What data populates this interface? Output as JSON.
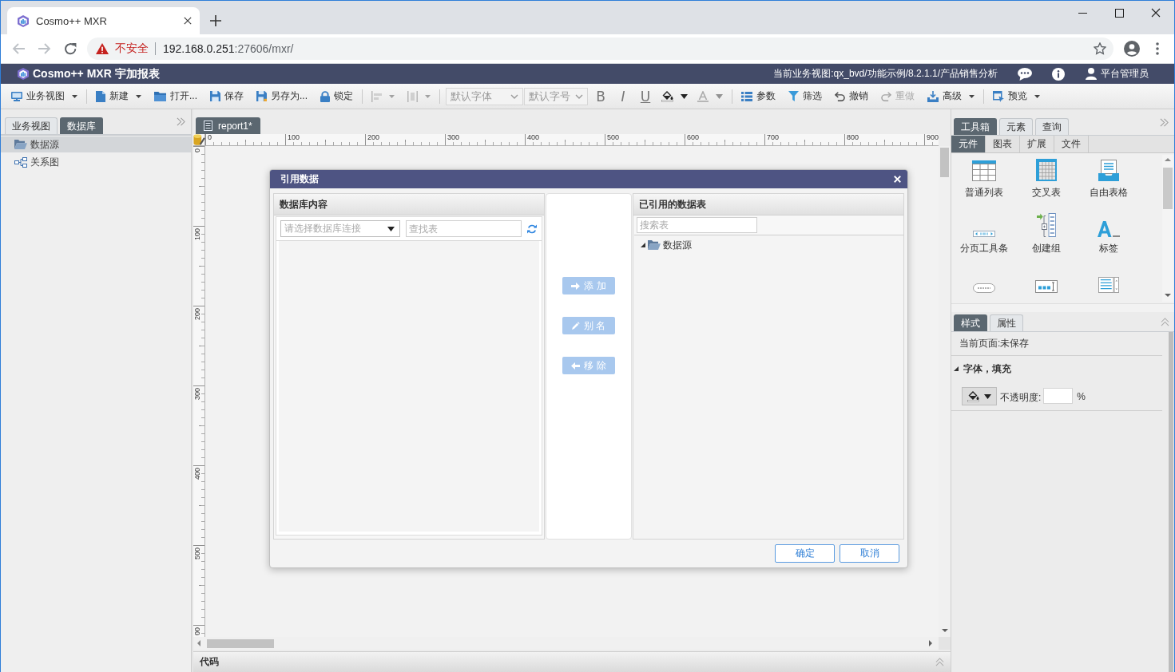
{
  "browser": {
    "tab_title": "Cosmo++ MXR",
    "security_label": "不安全",
    "url_host": "192.168.0.251",
    "url_rest": ":27606/mxr/"
  },
  "app": {
    "title": "Cosmo++ MXR 宇加报表",
    "context": "当前业务视图:qx_bvd/功能示例/8.2.1.1/产品销售分析",
    "user": "平台管理员"
  },
  "toolbar": {
    "groups": [
      [
        {
          "kind": "button",
          "label": "业务视图",
          "menu": true,
          "disabled": false
        }
      ],
      [
        {
          "kind": "button",
          "label": "新建",
          "menu": true,
          "disabled": false
        },
        {
          "kind": "button",
          "label": "打开...",
          "menu": false,
          "disabled": false
        },
        {
          "kind": "button",
          "label": "保存",
          "menu": false,
          "disabled": false
        },
        {
          "kind": "button",
          "label": "另存为...",
          "menu": false,
          "disabled": false
        },
        {
          "kind": "button",
          "label": "锁定",
          "menu": false,
          "disabled": false
        }
      ],
      [
        {
          "kind": "icon-button",
          "menu": true,
          "disabled": true
        },
        {
          "kind": "icon-button",
          "menu": true,
          "disabled": true
        }
      ],
      [
        {
          "kind": "select",
          "value": "默认字体",
          "disabled": true
        },
        {
          "kind": "select",
          "value": "默认字号",
          "disabled": true
        },
        {
          "kind": "bold",
          "label": "B",
          "disabled": false
        },
        {
          "kind": "italic",
          "label": "I",
          "disabled": false
        },
        {
          "kind": "underline",
          "label": "U",
          "disabled": false
        },
        {
          "kind": "icon-button",
          "menu": true,
          "disabled": false
        },
        {
          "kind": "icon-button",
          "menu": true,
          "disabled": true
        }
      ],
      [
        {
          "kind": "button",
          "label": "参数",
          "menu": false,
          "disabled": false
        },
        {
          "kind": "button",
          "label": "筛选",
          "menu": false,
          "disabled": false
        },
        {
          "kind": "button",
          "label": "撤销",
          "menu": false,
          "disabled": false
        },
        {
          "kind": "button",
          "label": "重做",
          "menu": false,
          "disabled": true
        },
        {
          "kind": "button",
          "label": "高级",
          "menu": true,
          "disabled": false
        }
      ],
      [
        {
          "kind": "button",
          "label": "预览",
          "menu": true,
          "disabled": false
        }
      ]
    ]
  },
  "left_panel": {
    "tabs": [
      {
        "label": "业务视图",
        "selected": false
      },
      {
        "label": "数据库",
        "selected": true
      }
    ],
    "tree": [
      {
        "kind": "folder",
        "label": "数据源",
        "selected": true
      },
      {
        "kind": "diagram",
        "label": "关系图",
        "selected": false
      }
    ]
  },
  "documents": [
    {
      "label": "report1*",
      "selected": true
    }
  ],
  "ruler": {
    "horizontal": [
      "0",
      "100",
      "200",
      "300",
      "400",
      "500",
      "600",
      "700",
      "800",
      "900"
    ],
    "vertical": [
      "0",
      "100",
      "200",
      "300",
      "400",
      "500",
      "00"
    ]
  },
  "dialog": {
    "title": "引用数据",
    "left": {
      "header": "数据库内容",
      "connection_placeholder": "请选择数据库连接",
      "search_placeholder": "查找表"
    },
    "actions": [
      {
        "label": "添 加",
        "disabled": true
      },
      {
        "label": "别 名",
        "disabled": true
      },
      {
        "label": "移 除",
        "disabled": true
      }
    ],
    "right": {
      "header": "已引用的数据表",
      "search_placeholder": "搜索表",
      "tree": [
        {
          "label": "数据源",
          "expanded": true
        }
      ]
    },
    "buttons": [
      {
        "label": "确定"
      },
      {
        "label": "取消"
      }
    ]
  },
  "right_panel": {
    "tabs": [
      {
        "label": "工具箱",
        "selected": true
      },
      {
        "label": "元素",
        "selected": false
      },
      {
        "label": "查询",
        "selected": false
      }
    ],
    "subtabs": [
      {
        "label": "元件",
        "selected": true
      },
      {
        "label": "图表",
        "selected": false
      },
      {
        "label": "扩展",
        "selected": false
      },
      {
        "label": "文件",
        "selected": false
      }
    ],
    "components": [
      {
        "kind": "table",
        "label": "普通列表"
      },
      {
        "kind": "crosstab",
        "label": "交叉表"
      },
      {
        "kind": "freeform",
        "label": "自由表格"
      },
      {
        "kind": "pager",
        "label": "分页工具条"
      },
      {
        "kind": "group",
        "label": "创建组"
      },
      {
        "kind": "label",
        "label": "标签"
      },
      {
        "kind": "button"
      },
      {
        "kind": "textbox"
      },
      {
        "kind": "textarea"
      }
    ],
    "lower_tabs": [
      {
        "label": "样式",
        "selected": true
      },
      {
        "label": "属性",
        "selected": false
      }
    ],
    "page_status": "当前页面:未保存",
    "section": {
      "title": "字体，填充",
      "expanded": true
    },
    "opacity_label": "不透明度:",
    "opacity_unit": "%"
  },
  "code_panel": {
    "title": "代码",
    "expanded": false
  }
}
